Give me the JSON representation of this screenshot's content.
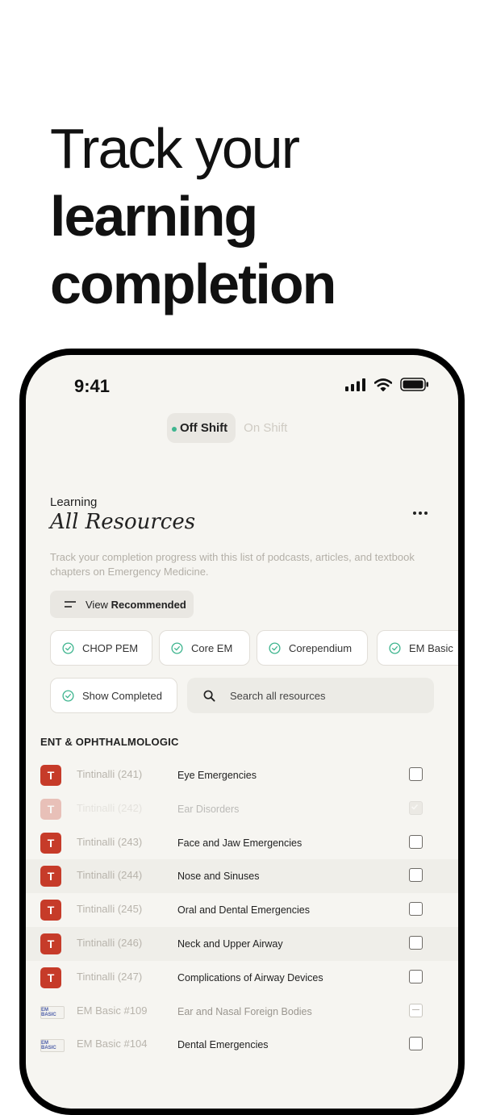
{
  "headline": {
    "line1": "Track your",
    "line2": "learning",
    "line3": "completion"
  },
  "status_bar": {
    "time": "9:41"
  },
  "shift_toggle": {
    "off_label": "Off Shift",
    "on_label": "On Shift"
  },
  "header": {
    "section": "Learning",
    "title": "All Resources",
    "description": "Track your completion progress with this list of podcasts, articles, and textbook chapters on Emergency Medicine."
  },
  "view_recommended": {
    "prefix": "View",
    "bold": "Recommended"
  },
  "filters": [
    "CHOP PEM",
    "Core EM",
    "Corependium",
    "EM Basic",
    "Show Completed"
  ],
  "search": {
    "placeholder": "Search all resources"
  },
  "group": {
    "name": "ENT & OPHTHALMOLOGIC"
  },
  "resources": [
    {
      "logo": "T",
      "source": "Tintinalli (241)",
      "title": "Eye Emergencies",
      "state": "unchecked"
    },
    {
      "logo": "T",
      "source": "Tintinalli (242)",
      "title": "Ear Disorders",
      "state": "completed"
    },
    {
      "logo": "T",
      "source": "Tintinalli (243)",
      "title": "Face and Jaw Emergencies",
      "state": "unchecked"
    },
    {
      "logo": "T",
      "source": "Tintinalli (244)",
      "title": "Nose and Sinuses",
      "state": "unchecked"
    },
    {
      "logo": "T",
      "source": "Tintinalli (245)",
      "title": "Oral and Dental Emergencies",
      "state": "unchecked"
    },
    {
      "logo": "T",
      "source": "Tintinalli (246)",
      "title": "Neck and Upper Airway",
      "state": "unchecked"
    },
    {
      "logo": "T",
      "source": "Tintinalli (247)",
      "title": "Complications of Airway Devices",
      "state": "unchecked"
    },
    {
      "logo": "EM BASIC",
      "source": "EM Basic #109",
      "title": "Ear and Nasal Foreign Bodies",
      "state": "partial"
    },
    {
      "logo": "EM BASIC",
      "source": "EM Basic #104",
      "title": "Dental Emergencies",
      "state": "unchecked"
    }
  ],
  "colors": {
    "accent": "#3fb58f",
    "tintinalli_logo": "#c63b29",
    "background": "#f6f5f1"
  },
  "icons": [
    "signal-icon",
    "wifi-icon",
    "battery-icon",
    "more-icon",
    "filter-lines-icon",
    "check-circle-icon",
    "search-icon",
    "checkbox-icon"
  ]
}
